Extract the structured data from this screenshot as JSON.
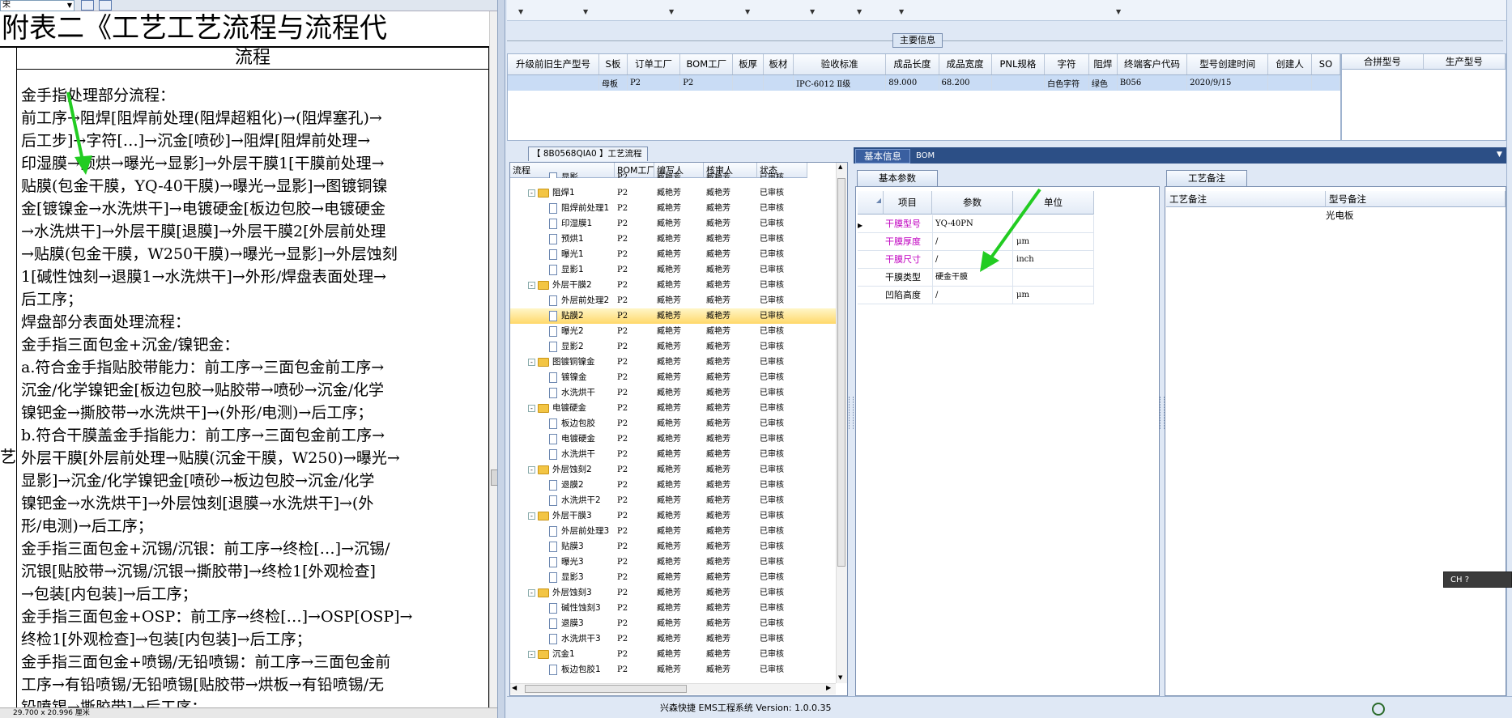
{
  "doc": {
    "combo_value": "宋",
    "title": "附表二《工艺工艺流程与流程代",
    "column_header": "流程",
    "side_char": "艺",
    "lines": [
      "金手指处理部分流程：",
      "前工序→阻焊[阻焊前处理(阻焊超粗化)→(阻焊塞孔)→",
      "后工步]→字符[…]→沉金[喷砂]→阻焊[阻焊前处理→",
      "印湿膜→预烘→曝光→显影]→外层干膜1[干膜前处理→",
      "贴膜(包金干膜，YQ-40干膜)→曝光→显影]→图镀铜镍",
      "金[镀镍金→水洗烘干]→电镀硬金[板边包胶→电镀硬金",
      "→水洗烘干]→外层干膜[退膜]→外层干膜2[外层前处理",
      "→贴膜(包金干膜，W250干膜)→曝光→显影]→外层蚀刻",
      "1[碱性蚀刻→退膜1→水洗烘干]→外形/焊盘表面处理→",
      "后工序；",
      "焊盘部分表面处理流程：",
      "金手指三面包金+沉金/镍钯金：",
      "a.符合金手指贴胶带能力：前工序→三面包金前工序→",
      "沉金/化学镍钯金[板边包胶→贴胶带→喷砂→沉金/化学",
      "镍钯金→撕胶带→水洗烘干]→(外形/电测)→后工序；",
      "b.符合干膜盖金手指能力：前工序→三面包金前工序→",
      "外层干膜[外层前处理→贴膜(沉金干膜，W250)→曝光→",
      "显影]→沉金/化学镍钯金[喷砂→板边包胶→沉金/化学",
      "镍钯金→水洗烘干]→外层蚀刻[退膜→水洗烘干]→(外",
      "形/电测)→后工序；",
      "金手指三面包金+沉锡/沉银：前工序→终检[…]→沉锡/",
      "沉银[贴胶带→沉锡/沉银→撕胶带]→终检1[外观检查]",
      "→包装[内包装]→后工序；",
      "金手指三面包金+OSP：前工序→终检[…]→OSP[OSP]→",
      "终检1[外观检查]→包装[内包装]→后工序；",
      "金手指三面包金+喷锡/无铅喷锡：前工序→三面包金前",
      "工序→有铅喷锡/无铅喷锡[贴胶带→烘板→有铅喷锡/无",
      "铅喷锡→撕胶带]→后工序；"
    ],
    "status": "29.700 x 20.996 厘米"
  },
  "main_info": {
    "label": "主要信息",
    "columns": [
      "升级前旧生产型号",
      "S板",
      "订单工厂",
      "BOM工厂",
      "板厚",
      "板材",
      "验收标准",
      "成品长度",
      "成品宽度",
      "PNL规格",
      "字符",
      "阻焊",
      "终端客户代码",
      "型号创建时间",
      "创建人",
      "SO"
    ],
    "row": [
      "",
      "母板",
      "P2",
      "P2",
      "",
      "",
      "IPC-6012 Ⅱ级",
      "89.000",
      "68.200",
      "",
      "白色字符",
      "绿色",
      "B056",
      "2020/9/15",
      "",
      ""
    ],
    "side_columns": [
      "合拼型号",
      "生产型号"
    ]
  },
  "tree": {
    "tab_label": "【 8B0568QIA0 】工艺流程",
    "columns": [
      "流程",
      "BOM工厂",
      "编写人",
      "核审人",
      "状态"
    ],
    "rows": [
      {
        "name": "显影",
        "level": 2,
        "group": false,
        "bom": "P2",
        "writer": "臧艳芳",
        "checker": "臧艳芳",
        "status": "已审核"
      },
      {
        "name": "阻焊1",
        "level": 1,
        "group": true,
        "bom": "P2",
        "writer": "臧艳芳",
        "checker": "臧艳芳",
        "status": "已审核"
      },
      {
        "name": "阻焊前处理1",
        "level": 2,
        "group": false,
        "bom": "P2",
        "writer": "臧艳芳",
        "checker": "臧艳芳",
        "status": "已审核"
      },
      {
        "name": "印湿膜1",
        "level": 2,
        "group": false,
        "bom": "P2",
        "writer": "臧艳芳",
        "checker": "臧艳芳",
        "status": "已审核"
      },
      {
        "name": "预烘1",
        "level": 2,
        "group": false,
        "bom": "P2",
        "writer": "臧艳芳",
        "checker": "臧艳芳",
        "status": "已审核"
      },
      {
        "name": "曝光1",
        "level": 2,
        "group": false,
        "bom": "P2",
        "writer": "臧艳芳",
        "checker": "臧艳芳",
        "status": "已审核"
      },
      {
        "name": "显影1",
        "level": 2,
        "group": false,
        "bom": "P2",
        "writer": "臧艳芳",
        "checker": "臧艳芳",
        "status": "已审核"
      },
      {
        "name": "外层干膜2",
        "level": 1,
        "group": true,
        "bom": "P2",
        "writer": "臧艳芳",
        "checker": "臧艳芳",
        "status": "已审核"
      },
      {
        "name": "外层前处理2",
        "level": 2,
        "group": false,
        "bom": "P2",
        "writer": "臧艳芳",
        "checker": "臧艳芳",
        "status": "已审核"
      },
      {
        "name": "贴膜2",
        "level": 2,
        "group": false,
        "bom": "P2",
        "writer": "臧艳芳",
        "checker": "臧艳芳",
        "status": "已审核",
        "selected": true
      },
      {
        "name": "曝光2",
        "level": 2,
        "group": false,
        "bom": "P2",
        "writer": "臧艳芳",
        "checker": "臧艳芳",
        "status": "已审核"
      },
      {
        "name": "显影2",
        "level": 2,
        "group": false,
        "bom": "P2",
        "writer": "臧艳芳",
        "checker": "臧艳芳",
        "status": "已审核"
      },
      {
        "name": "图镀铜镍金",
        "level": 1,
        "group": true,
        "bom": "P2",
        "writer": "臧艳芳",
        "checker": "臧艳芳",
        "status": "已审核"
      },
      {
        "name": "镀镍金",
        "level": 2,
        "group": false,
        "bom": "P2",
        "writer": "臧艳芳",
        "checker": "臧艳芳",
        "status": "已审核"
      },
      {
        "name": "水洗烘干",
        "level": 2,
        "group": false,
        "bom": "P2",
        "writer": "臧艳芳",
        "checker": "臧艳芳",
        "status": "已审核"
      },
      {
        "name": "电镀硬金",
        "level": 1,
        "group": true,
        "bom": "P2",
        "writer": "臧艳芳",
        "checker": "臧艳芳",
        "status": "已审核"
      },
      {
        "name": "板边包胶",
        "level": 2,
        "group": false,
        "bom": "P2",
        "writer": "臧艳芳",
        "checker": "臧艳芳",
        "status": "已审核"
      },
      {
        "name": "电镀硬金",
        "level": 2,
        "group": false,
        "bom": "P2",
        "writer": "臧艳芳",
        "checker": "臧艳芳",
        "status": "已审核"
      },
      {
        "name": "水洗烘干",
        "level": 2,
        "group": false,
        "bom": "P2",
        "writer": "臧艳芳",
        "checker": "臧艳芳",
        "status": "已审核"
      },
      {
        "name": "外层蚀刻2",
        "level": 1,
        "group": true,
        "bom": "P2",
        "writer": "臧艳芳",
        "checker": "臧艳芳",
        "status": "已审核"
      },
      {
        "name": "退膜2",
        "level": 2,
        "group": false,
        "bom": "P2",
        "writer": "臧艳芳",
        "checker": "臧艳芳",
        "status": "已审核"
      },
      {
        "name": "水洗烘干2",
        "level": 2,
        "group": false,
        "bom": "P2",
        "writer": "臧艳芳",
        "checker": "臧艳芳",
        "status": "已审核"
      },
      {
        "name": "外层干膜3",
        "level": 1,
        "group": true,
        "bom": "P2",
        "writer": "臧艳芳",
        "checker": "臧艳芳",
        "status": "已审核"
      },
      {
        "name": "外层前处理3",
        "level": 2,
        "group": false,
        "bom": "P2",
        "writer": "臧艳芳",
        "checker": "臧艳芳",
        "status": "已审核"
      },
      {
        "name": "贴膜3",
        "level": 2,
        "group": false,
        "bom": "P2",
        "writer": "臧艳芳",
        "checker": "臧艳芳",
        "status": "已审核"
      },
      {
        "name": "曝光3",
        "level": 2,
        "group": false,
        "bom": "P2",
        "writer": "臧艳芳",
        "checker": "臧艳芳",
        "status": "已审核"
      },
      {
        "name": "显影3",
        "level": 2,
        "group": false,
        "bom": "P2",
        "writer": "臧艳芳",
        "checker": "臧艳芳",
        "status": "已审核"
      },
      {
        "name": "外层蚀刻3",
        "level": 1,
        "group": true,
        "bom": "P2",
        "writer": "臧艳芳",
        "checker": "臧艳芳",
        "status": "已审核"
      },
      {
        "name": "碱性蚀刻3",
        "level": 2,
        "group": false,
        "bom": "P2",
        "writer": "臧艳芳",
        "checker": "臧艳芳",
        "status": "已审核"
      },
      {
        "name": "退膜3",
        "level": 2,
        "group": false,
        "bom": "P2",
        "writer": "臧艳芳",
        "checker": "臧艳芳",
        "status": "已审核"
      },
      {
        "name": "水洗烘干3",
        "level": 2,
        "group": false,
        "bom": "P2",
        "writer": "臧艳芳",
        "checker": "臧艳芳",
        "status": "已审核"
      },
      {
        "name": "沉金1",
        "level": 1,
        "group": true,
        "bom": "P2",
        "writer": "臧艳芳",
        "checker": "臧艳芳",
        "status": "已审核"
      },
      {
        "name": "板边包胶1",
        "level": 2,
        "group": false,
        "bom": "P2",
        "writer": "臧艳芳",
        "checker": "臧艳芳",
        "status": "已审核"
      }
    ]
  },
  "tabs": {
    "basic": "基本信息",
    "bom": "BOM"
  },
  "params": {
    "tab_label": "基本参数",
    "columns": [
      "项目",
      "参数",
      "单位"
    ],
    "rows": [
      {
        "key": "干膜型号",
        "value": "YQ-40PN",
        "unit": "",
        "pink": true,
        "current": true
      },
      {
        "key": "干膜厚度",
        "value": "/",
        "unit": "μm",
        "pink": true
      },
      {
        "key": "干膜尺寸",
        "value": "/",
        "unit": "inch",
        "pink": true
      },
      {
        "key": "干膜类型",
        "value": "硬金干膜",
        "unit": "",
        "pink": false
      },
      {
        "key": "凹陷高度",
        "value": "/",
        "unit": "μm",
        "pink": false
      }
    ]
  },
  "remarks": {
    "tab_label": "工艺备注",
    "columns": [
      "工艺备注",
      "型号备注"
    ],
    "model_remark": "光电板"
  },
  "status": {
    "text": "兴森快捷 EMS工程系统 Version: 1.0.0.35"
  },
  "ime": {
    "label": "CH"
  }
}
